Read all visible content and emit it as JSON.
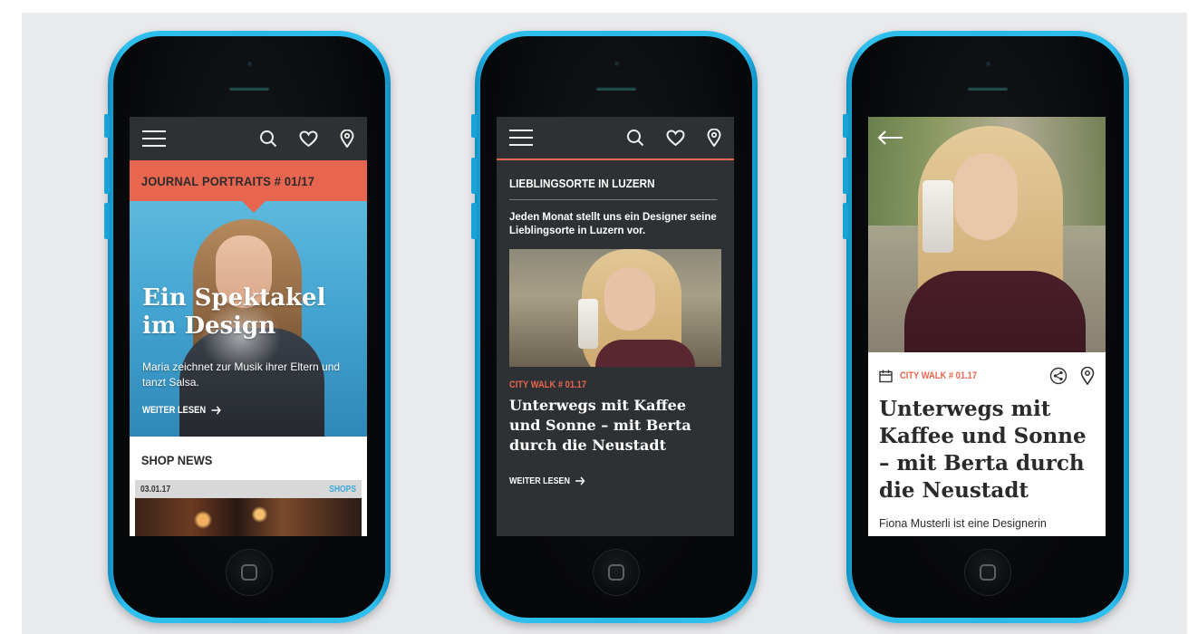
{
  "colors": {
    "accent": "#e8664f",
    "phone_body": "#2ab8e8",
    "navbar": "#2e3133",
    "link_blue": "#39a9df"
  },
  "icons": {
    "menu": "hamburger-icon",
    "search": "search-icon",
    "favorite": "heart-icon",
    "location": "map-pin-icon",
    "arrow": "arrow-right-icon",
    "back": "arrow-left-icon",
    "calendar": "calendar-icon",
    "share": "share-icon"
  },
  "phone1": {
    "banner": "JOURNAL PORTRAITS # 01/17",
    "hero_title": "Ein Spektakel im Design",
    "hero_text": "Maria zeichnet zur Musik ihrer Eltern und tanzt Salsa.",
    "read_more": "WEITER LESEN",
    "shop_heading": "SHOP NEWS",
    "shop_date": "03.01.17",
    "shop_link": "SHOPS"
  },
  "phone2": {
    "title": "LIEBLINGSORTE IN LUZERN",
    "description": "Jeden Monat stellt uns ein Designer seine Lieblingsorte in Luzern vor.",
    "kicker": "CITY WALK # 01.17",
    "headline": "Unterwegs mit Kaffee und Sonne – mit Berta durch die Neustadt",
    "read_more": "WEITER LESEN"
  },
  "phone3": {
    "kicker": "CITY WALK # 01.17",
    "headline": "Unterwegs mit Kaffee und Sonne – mit Berta durch die Neustadt",
    "lead": "Fiona Musterli ist eine Designerin"
  }
}
